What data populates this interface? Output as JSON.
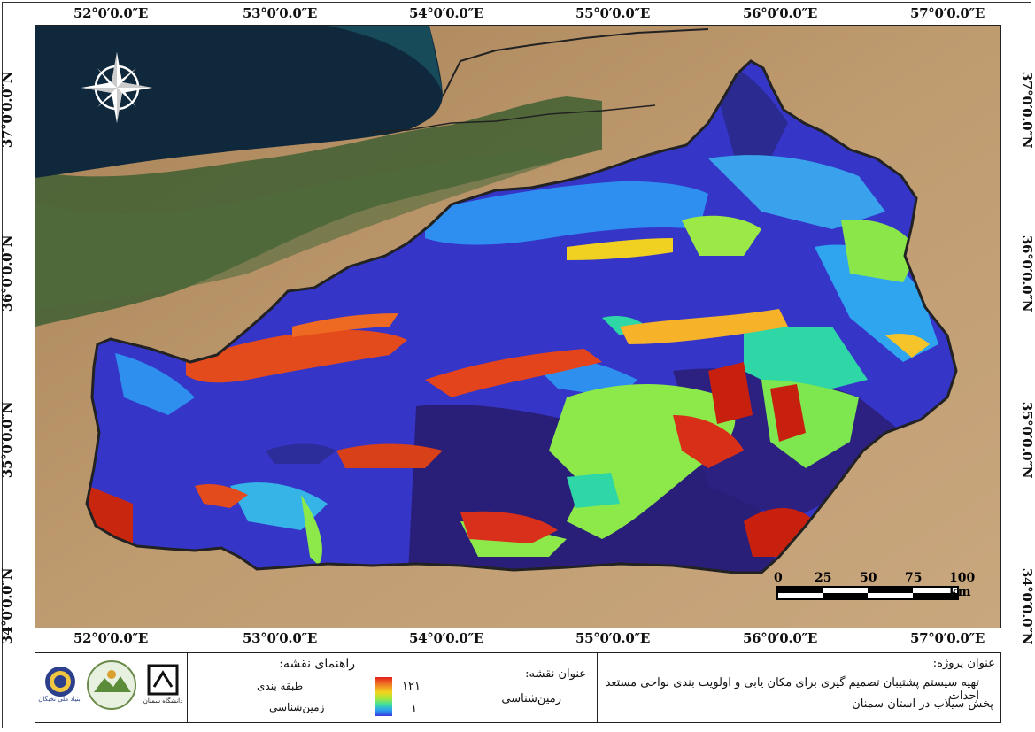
{
  "map": {
    "top_coords": [
      "52°0′0.0″E",
      "53°0′0.0″E",
      "54°0′0.0″E",
      "55°0′0.0″E",
      "56°0′0.0″E",
      "57°0′0.0″E"
    ],
    "bottom_coords": [
      "52°0′0.0″E",
      "53°0′0.0″E",
      "54°0′0.0″E",
      "55°0′0.0″E",
      "56°0′0.0″E",
      "57°0′0.0″E"
    ],
    "left_coords": [
      "37°0′0.0″N",
      "36°0′0.0″N",
      "35°0′0.0″N",
      "34°0′0.0″N"
    ],
    "right_coords": [
      "37°0′0.0″N",
      "36°0′0.0″N",
      "35°0′0.0″N",
      "34°0′0.0″N"
    ],
    "scale": {
      "labels": [
        "0",
        "25",
        "50",
        "75",
        "100 km"
      ]
    },
    "north_arrow_icon": "compass-rose-icon",
    "colors": {
      "sea": "#0f2a3d",
      "land": "#b58c61",
      "vegetation": "#3d5a2e",
      "class_low": "#3a3ae0",
      "class_high": "#e3201c",
      "boundary": "#222222"
    }
  },
  "legend": {
    "title": "راهنمای نقشه:",
    "items": [
      "طبقه بندی",
      "زمین‌شناسی"
    ],
    "ramp_high": "۱۲۱",
    "ramp_low": "۱"
  },
  "map_title": {
    "label": "عنوان نقشه:",
    "value": "زمین‌شناسی"
  },
  "project": {
    "label": "عنوان پروژه:",
    "line1": "تهیه سیستم پشتیبان تصمیم گیری برای مکان یابی و اولویت بندی نواحی مستعد احداث",
    "line2": "پخش سیلاب در استان سمنان"
  },
  "logos": {
    "foundation_text": "بنیاد ملی نخبگان",
    "university_text": "دانشگاه سمنان",
    "icons": [
      "elites-foundation-logo",
      "institute-seal-logo",
      "semnan-university-logo"
    ]
  }
}
